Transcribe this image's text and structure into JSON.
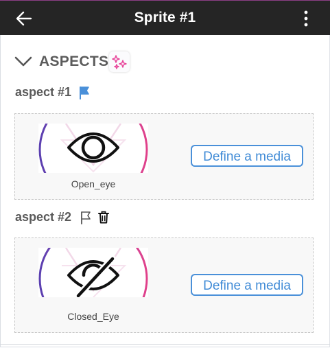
{
  "header": {
    "title": "Sprite #1"
  },
  "section": {
    "title": "ASPECTS"
  },
  "aspects": [
    {
      "title": "aspect #1",
      "image_caption": "Open_eye",
      "media_button": "Define a media",
      "flag_state": "filled"
    },
    {
      "title": "aspect #2",
      "image_caption": "Closed_Eye",
      "media_button": "Define a media",
      "flag_state": "outline"
    }
  ],
  "colors": {
    "header_bg": "#252525",
    "accent_blue": "#4a90d9",
    "sparkle_pink": "#e8459a"
  }
}
